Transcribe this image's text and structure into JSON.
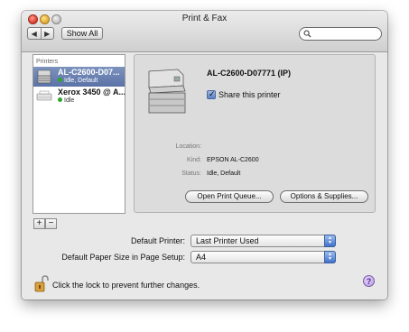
{
  "window": {
    "title": "Print & Fax"
  },
  "toolbar": {
    "back": "◀",
    "forward": "▶",
    "show_all": "Show All",
    "search_value": ""
  },
  "sidebar": {
    "header": "Printers",
    "items": [
      {
        "name": "AL-C2600-D07...",
        "status": "Idle, Default",
        "selected": true
      },
      {
        "name": "Xerox 3450 @ A...",
        "status": "Idle",
        "selected": false
      }
    ],
    "add": "+",
    "remove": "−"
  },
  "detail": {
    "printer_name": "AL-C2600-D07771 (IP)",
    "share_label": "Share this printer",
    "share_checked": true,
    "location_label": "Location:",
    "location_value": "",
    "kind_label": "Kind:",
    "kind_value": "EPSON AL-C2600",
    "status_label": "Status:",
    "status_value": "Idle, Default",
    "open_queue": "Open Print Queue...",
    "options_supplies": "Options & Supplies..."
  },
  "defaults": {
    "printer_label": "Default Printer:",
    "printer_value": "Last Printer Used",
    "paper_label": "Default Paper Size in Page Setup:",
    "paper_value": "A4"
  },
  "footer": {
    "lock_text": "Click the lock to prevent further changes.",
    "help": "?"
  },
  "colors": {
    "selection": "#6a82b4",
    "status_green": "#2fa52f",
    "popup_accent": "#3f72cc"
  }
}
